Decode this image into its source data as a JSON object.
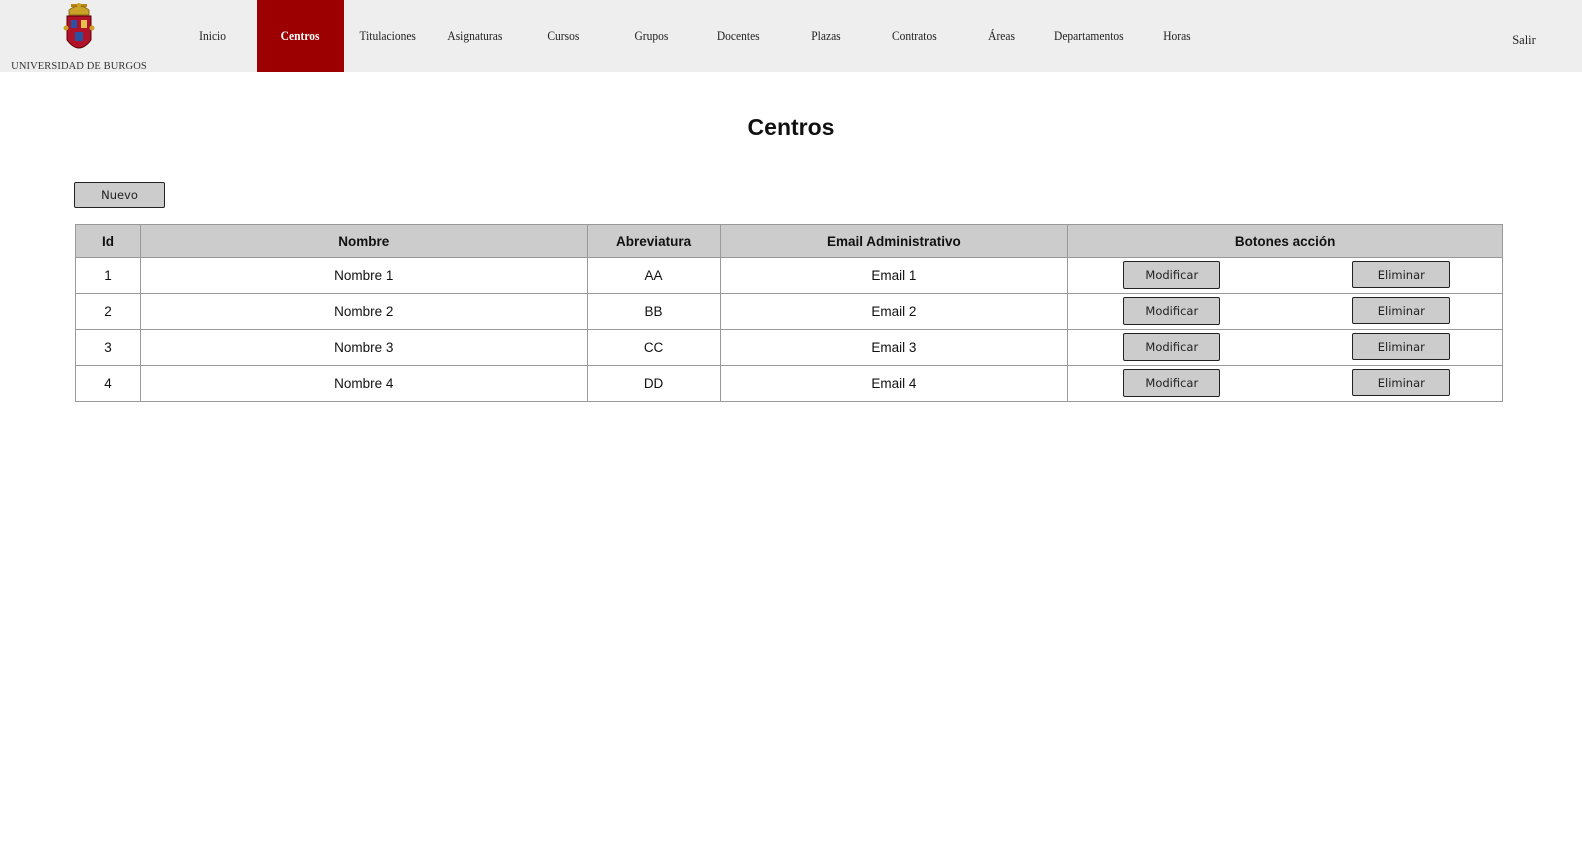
{
  "header": {
    "logo_text": "UNIVERSIDAD DE BURGOS",
    "nav": [
      {
        "label": "Inicio"
      },
      {
        "label": "Centros"
      },
      {
        "label": "Titulaciones"
      },
      {
        "label": "Asignaturas"
      },
      {
        "label": "Cursos"
      },
      {
        "label": "Grupos"
      },
      {
        "label": "Docentes"
      },
      {
        "label": "Plazas"
      },
      {
        "label": "Contratos"
      },
      {
        "label": "Áreas"
      },
      {
        "label": "Departamentos"
      },
      {
        "label": "Horas"
      }
    ],
    "active": "Centros",
    "logout_label": "Salir"
  },
  "main": {
    "title": "Centros",
    "new_button": "Nuevo",
    "table": {
      "columns": [
        "Id",
        "Nombre",
        "Abreviatura",
        "Email Administrativo",
        "Botones acción"
      ],
      "rows": [
        {
          "id": "1",
          "nombre": "Nombre 1",
          "abreviatura": "AA",
          "email": "Email 1"
        },
        {
          "id": "2",
          "nombre": "Nombre 2",
          "abreviatura": "BB",
          "email": "Email 2"
        },
        {
          "id": "3",
          "nombre": "Nombre 3",
          "abreviatura": "CC",
          "email": "Email 3"
        },
        {
          "id": "4",
          "nombre": "Nombre 4",
          "abreviatura": "DD",
          "email": "Email 4"
        }
      ],
      "modify_label": "Modificar",
      "delete_label": "Eliminar"
    }
  },
  "colors": {
    "active_nav": "#9c0000",
    "topbar": "#eeeeee",
    "header_cell": "#cccccc",
    "button": "#cccccc"
  }
}
